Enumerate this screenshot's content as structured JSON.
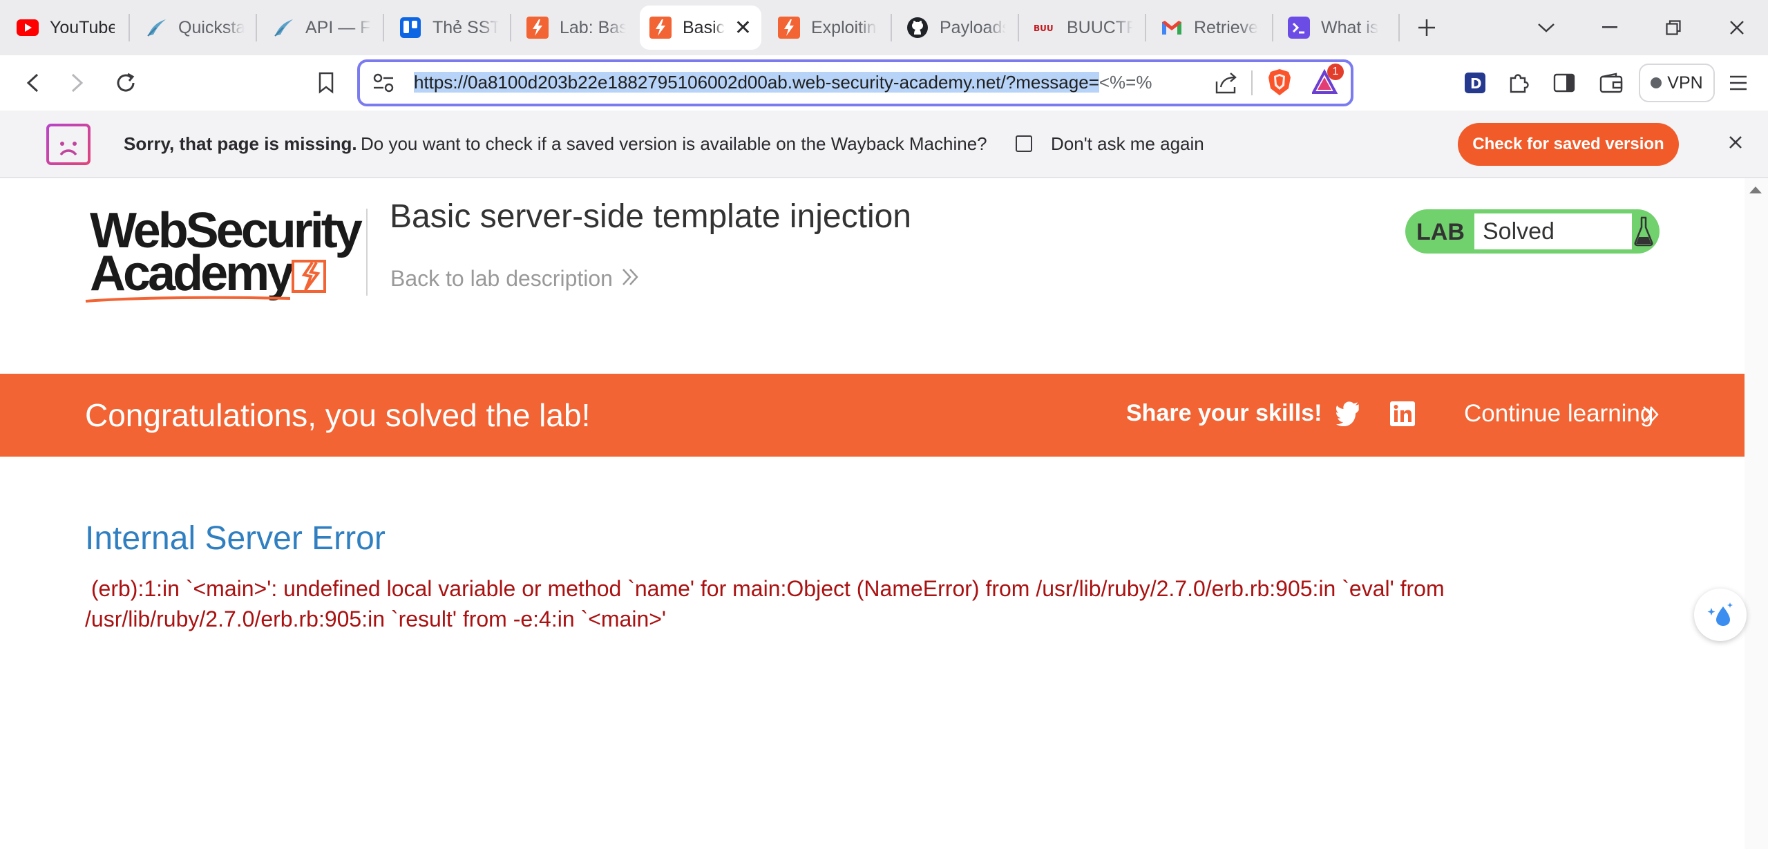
{
  "tabs": [
    {
      "title": "YouTube",
      "icon": "youtube-icon",
      "color": "#ff0000"
    },
    {
      "title": "Quickstart",
      "icon": "flask-feather-icon",
      "color": "#5aa1c7"
    },
    {
      "title": "API — Flask",
      "icon": "flask-feather-icon",
      "color": "#5aa1c7"
    },
    {
      "title": "Thẻ SSTI",
      "icon": "trello-icon",
      "color": "#0c66e4"
    },
    {
      "title": "Lab: Basic",
      "icon": "portswigger-icon",
      "color": "#f26434"
    },
    {
      "title": "Basic",
      "icon": "portswigger-icon",
      "color": "#f26434",
      "active": true
    },
    {
      "title": "Exploiting",
      "icon": "portswigger-icon",
      "color": "#f26434"
    },
    {
      "title": "Payloads",
      "icon": "github-icon",
      "color": "#1f2328"
    },
    {
      "title": "BUUCTF",
      "icon": "buuctf-icon",
      "color": "#c4161c"
    },
    {
      "title": "Retrieve",
      "icon": "gmail-icon",
      "color": "#ea4335"
    },
    {
      "title": "What is",
      "icon": "terminal-icon",
      "color": "#6b4de6"
    }
  ],
  "browser": {
    "url_selected": "https://0a8100d203b22e1882795106002d00ab.web-security-academy.net/?message=",
    "url_rest": "<%=%",
    "vpn_label": "VPN",
    "brave_badge_count": "1"
  },
  "infobar": {
    "bold_text": "Sorry, that page is missing.",
    "text": "Do you want to check if a saved version is available on the Wayback Machine?",
    "checkbox_label": "Don't ask me again",
    "button_label": "Check for saved version"
  },
  "header": {
    "logo_line1": "WebSecurity",
    "logo_line2": "Academy",
    "lab_title": "Basic server-side template injection",
    "back_link": "Back to lab description",
    "badge_label": "LAB",
    "badge_status": "Solved"
  },
  "banner": {
    "title": "Congratulations, you solved the lab!",
    "share": "Share your skills!",
    "continue": "Continue learning"
  },
  "error": {
    "title": "Internal Server Error",
    "line1": "(erb):1:in `<main>': undefined local variable or method `name' for main:Object (NameError) from /usr/lib/ruby/2.7.0/erb.rb:905:in `eval' from",
    "line2": "/usr/lib/ruby/2.7.0/erb.rb:905:in `result' from -e:4:in `<main>'"
  },
  "colors": {
    "accent_orange": "#f26434",
    "lab_green": "#70d16d",
    "error_red": "#aa1111",
    "heading_blue": "#2f7fc1"
  }
}
